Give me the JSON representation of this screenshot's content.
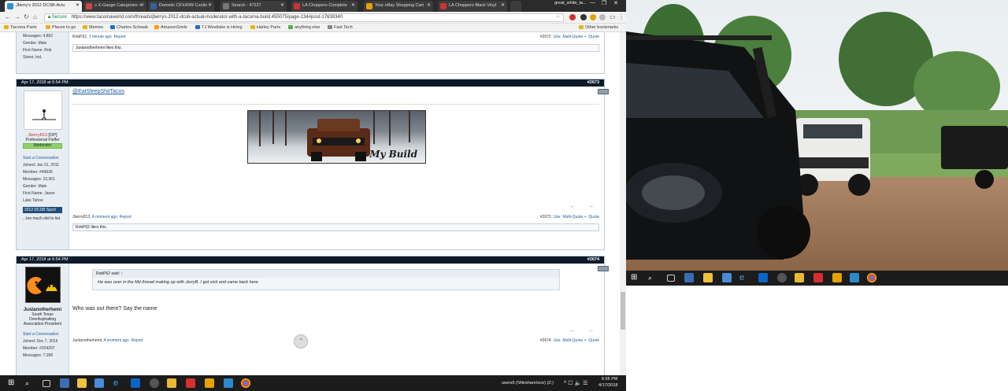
{
  "browser": {
    "tabs": [
      {
        "label": "Jberry's 2012 DCSB-Actu",
        "active": true,
        "color": "#2b8fd8"
      },
      {
        "label": "» X-Gauge Categories »",
        "color": "#cc4444"
      },
      {
        "label": "Dometic CFX40W Coolin",
        "color": "#3a5fa0"
      },
      {
        "label": "Search - 47227",
        "color": "#777"
      },
      {
        "label": "LA Choppers Complete",
        "color": "#c33"
      },
      {
        "label": "Your eBay Shopping Cart",
        "color": "#e6a100"
      },
      {
        "label": "LA Choppers Black Vinyl",
        "color": "#c33"
      }
    ],
    "window_user": "great_white_ta...",
    "window_controls": [
      "—",
      "❐",
      "✕"
    ],
    "secure_label": "Secure",
    "url": "https://www.tacomaworld.com/threads/jberrys-2012-dcsb-actual-moderator-with-a-tacoma-build.455075/page-134#post-17638340",
    "bookmarks": [
      {
        "label": "Tacoma Parts"
      },
      {
        "label": "Places to go"
      },
      {
        "label": "Memes"
      },
      {
        "label": "Charles Schwab"
      },
      {
        "label": "AmazonSmile"
      },
      {
        "label": "TJ Westlake is Hiring"
      },
      {
        "label": "Harley Parts"
      },
      {
        "label": "anything else"
      },
      {
        "label": "Fast Tech"
      }
    ],
    "other_bookmarks": "Other bookmarks"
  },
  "prev_post": {
    "user_lines": [
      "Messages: 4,862",
      "Gender: Male",
      "First Name: Rob",
      "Street, Ind."
    ],
    "meta_user": "RobP62,",
    "meta_time": "1 minute ago",
    "meta_report": "Report",
    "meta_right": "#2672",
    "like_label": "Like",
    "multiquote": "Multi-Quote +",
    "quote": "Quote",
    "likes_text": "Justanotherhemi likes this."
  },
  "post2673": {
    "date": "Apr 17, 2018 at 6:54 PM",
    "num": "#2673",
    "mention": "@EatSleepShitTacos",
    "username": "Jberry813",
    "op_tag": "[OP]",
    "title": "Professional Fluffer",
    "badge": "Moderator",
    "user_lines": [
      "Start a Conversation",
      "Joined: Jan 21, 2011",
      "Member: #49636",
      "Messages: 22,361",
      "Gender: Male",
      "First Name: Jason",
      "Lake Tahoe"
    ],
    "vehicle": "2012 DCSB Sport",
    "sig": "...too much shit to list.",
    "banner_text": "My Build",
    "meta_user": "Jberry813,",
    "meta_time": "A moment ago",
    "meta_report": "Report",
    "meta_right": "#2673",
    "like_label": "Like",
    "multiquote": "Multi-Quote +",
    "quote": "Quote",
    "likes_text": "RobP62 likes this."
  },
  "post2674": {
    "date": "Apr 17, 2018 at 6:54 PM",
    "num": "#2674",
    "quote_author": "RobP62 said: ↑",
    "quote_text": "He was over in the Md thread making up with JerryB. I got sick and came back here.",
    "body": "Who was out there? Say the name",
    "username": "Justanotherhemi",
    "user_title_lines": [
      "South Texas",
      "OverAsphalting",
      "Association President"
    ],
    "user_lines": [
      "Start a Conversation",
      "Joined: Dec 7, 2016",
      "Member: #204297",
      "Messages: 7,358"
    ],
    "meta_user": "Justanotherhemi,",
    "meta_time": "A moment ago",
    "meta_report": "Report",
    "meta_right": "#2674",
    "like_label": "Like",
    "multiquote": "Multi-Quote +",
    "quote": "Quote"
  },
  "taskbar": {
    "tray_drive": "users5 (\\\\fileshare\\oce) (Z:)",
    "clock_time": "6:56 PM",
    "clock_date": "4/17/2018"
  }
}
